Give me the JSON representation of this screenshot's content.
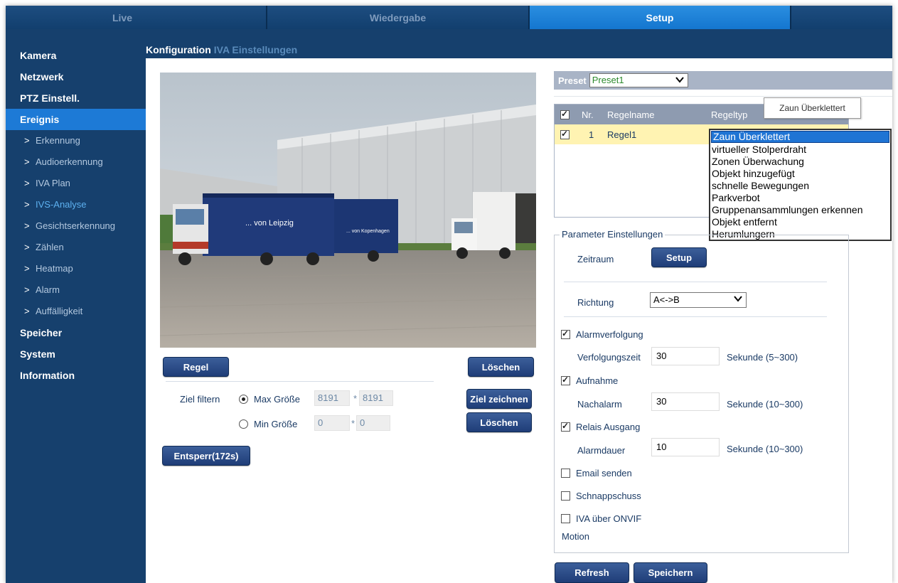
{
  "topnav": {
    "tabs": [
      {
        "label": "Live",
        "active": false
      },
      {
        "label": "Wiedergabe",
        "active": false
      },
      {
        "label": "Setup",
        "active": true
      },
      {
        "label": "",
        "active": false
      }
    ]
  },
  "sidebar": {
    "items": [
      {
        "label": "Kamera",
        "type": "main",
        "active": false
      },
      {
        "label": "Netzwerk",
        "type": "main",
        "active": false
      },
      {
        "label": "PTZ Einstell.",
        "type": "main",
        "active": false
      },
      {
        "label": "Ereignis",
        "type": "main",
        "active": true
      },
      {
        "label": "Erkennung",
        "type": "sub",
        "active": false
      },
      {
        "label": "Audioerkennung",
        "type": "sub",
        "active": false
      },
      {
        "label": "IVA Plan",
        "type": "sub",
        "active": false
      },
      {
        "label": "IVS-Analyse",
        "type": "sub",
        "active": true
      },
      {
        "label": "Gesichtserkennung",
        "type": "sub",
        "active": false
      },
      {
        "label": "Zählen",
        "type": "sub",
        "active": false
      },
      {
        "label": "Heatmap",
        "type": "sub",
        "active": false
      },
      {
        "label": "Alarm",
        "type": "sub",
        "active": false
      },
      {
        "label": "Auffälligkeit",
        "type": "sub",
        "active": false
      },
      {
        "label": "Speicher",
        "type": "main",
        "active": false
      },
      {
        "label": "System",
        "type": "main",
        "active": false
      },
      {
        "label": "Information",
        "type": "main",
        "active": false
      }
    ]
  },
  "content_tabs": {
    "config": "Konfiguration",
    "iva": "IVA Einstellungen"
  },
  "camera": {
    "truck_text_1": "... von Leipzig",
    "truck_text_2": "... von Kopenhagen"
  },
  "left_controls": {
    "regel_button": "Regel",
    "loeschen_top_button": "Löschen",
    "ziel_filtern_label": "Ziel filtern",
    "max_size_label": "Max Größe",
    "max_w": "8191",
    "max_h": "8191",
    "min_size_label": "Min Größe",
    "min_w": "0",
    "min_h": "0",
    "times": "*",
    "ziel_zeichnen_button": "Ziel zeichnen",
    "loeschen_button": "Löschen",
    "entsperr_button": "Entsperr(172s)"
  },
  "preset": {
    "label": "Preset",
    "value": "Preset1"
  },
  "rule_table": {
    "headers": {
      "nr": "Nr.",
      "name": "Regelname",
      "type": "Regeltyp"
    },
    "rows": [
      {
        "nr": "1",
        "name": "Regel1",
        "checked": true
      }
    ]
  },
  "tooltip": "Zaun Überklettert",
  "rule_type_options": [
    {
      "label": "Zaun Überklettert",
      "selected": true
    },
    {
      "label": "virtueller Stolperdraht",
      "selected": false
    },
    {
      "label": "Zonen Überwachung",
      "selected": false
    },
    {
      "label": "Objekt hinzugefügt",
      "selected": false
    },
    {
      "label": "schnelle Bewegungen",
      "selected": false
    },
    {
      "label": "Parkverbot",
      "selected": false
    },
    {
      "label": "Gruppenansammlungen erkennen",
      "selected": false
    },
    {
      "label": "Objekt entfernt",
      "selected": false
    },
    {
      "label": "Herumlungern",
      "selected": false
    }
  ],
  "params": {
    "title": "Parameter Einstellungen",
    "zeitraum_label": "Zeitraum",
    "setup_button": "Setup",
    "richtung_label": "Richtung",
    "richtung_value": "A<->B",
    "alarmverfolgung_label": "Alarmverfolgung",
    "alarmverfolgung_checked": true,
    "verfolgungszeit_label": "Verfolgungszeit",
    "verfolgungszeit_value": "30",
    "verfolgungszeit_unit": "Sekunde (5~300)",
    "aufnahme_label": "Aufnahme",
    "aufnahme_checked": true,
    "nachalarm_label": "Nachalarm",
    "nachalarm_value": "30",
    "nachalarm_unit": "Sekunde (10~300)",
    "relais_label": "Relais Ausgang",
    "relais_checked": true,
    "alarmdauer_label": "Alarmdauer",
    "alarmdauer_value": "10",
    "alarmdauer_unit": "Sekunde (10~300)",
    "email_label": "Email senden",
    "email_checked": false,
    "schnappschuss_label": "Schnappschuss",
    "schnappschuss_checked": false,
    "onvif_label": "IVA über ONVIF",
    "onvif_checked": false,
    "motion_label": "Motion"
  },
  "footer_buttons": {
    "refresh": "Refresh",
    "save": "Speichern"
  }
}
